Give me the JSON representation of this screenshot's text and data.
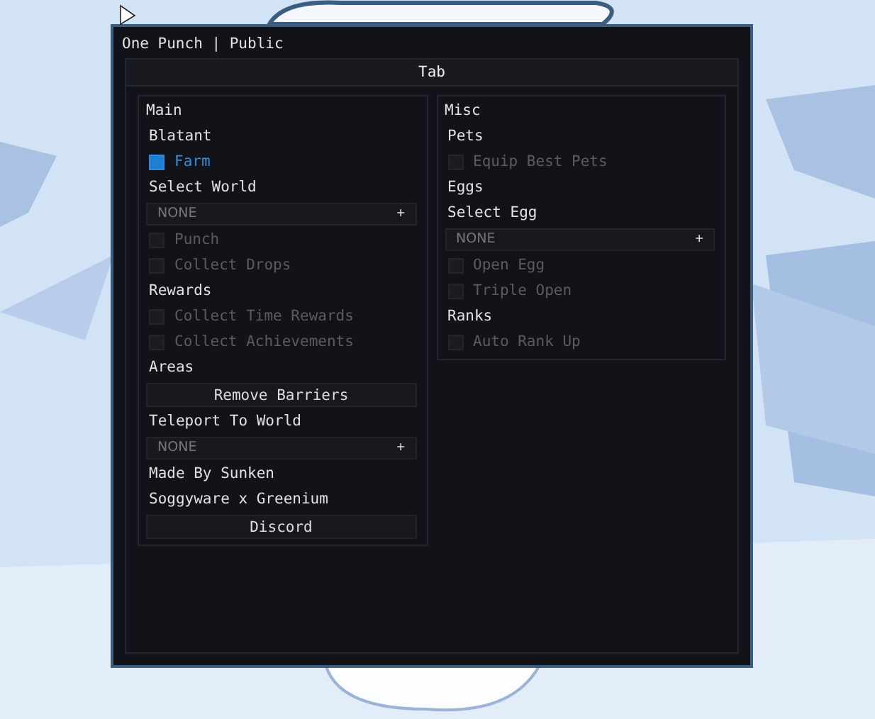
{
  "window": {
    "title": "One Punch | Public"
  },
  "tabs": [
    {
      "label": "Tab",
      "selected": true
    }
  ],
  "columns": [
    {
      "title": "Main",
      "items": [
        {
          "kind": "label",
          "text": "Blatant"
        },
        {
          "kind": "toggle",
          "text": "Farm",
          "checked": true
        },
        {
          "kind": "label",
          "text": "Select World"
        },
        {
          "kind": "dropdown",
          "value": "NONE",
          "icon": "+"
        },
        {
          "kind": "toggle",
          "text": "Punch",
          "checked": false
        },
        {
          "kind": "toggle",
          "text": "Collect Drops",
          "checked": false
        },
        {
          "kind": "label",
          "text": "Rewards"
        },
        {
          "kind": "toggle",
          "text": "Collect Time Rewards",
          "checked": false
        },
        {
          "kind": "toggle",
          "text": "Collect Achievements",
          "checked": false
        },
        {
          "kind": "label",
          "text": "Areas"
        },
        {
          "kind": "button",
          "text": "Remove Barriers"
        },
        {
          "kind": "label",
          "text": "Teleport To World"
        },
        {
          "kind": "dropdown",
          "value": "NONE",
          "icon": "+"
        },
        {
          "kind": "label",
          "text": "Made By Sunken"
        },
        {
          "kind": "label",
          "text": "Soggyware x Greenium"
        },
        {
          "kind": "button",
          "text": "Discord"
        }
      ]
    },
    {
      "title": "Misc",
      "items": [
        {
          "kind": "label",
          "text": "Pets"
        },
        {
          "kind": "toggle",
          "text": "Equip Best Pets",
          "checked": false
        },
        {
          "kind": "label",
          "text": "Eggs"
        },
        {
          "kind": "label",
          "text": "Select Egg"
        },
        {
          "kind": "dropdown",
          "value": "NONE",
          "icon": "+"
        },
        {
          "kind": "toggle",
          "text": "Open Egg",
          "checked": false
        },
        {
          "kind": "toggle",
          "text": "Triple Open",
          "checked": false
        },
        {
          "kind": "label",
          "text": "Ranks"
        },
        {
          "kind": "toggle",
          "text": "Auto Rank Up",
          "checked": false
        }
      ]
    }
  ]
}
